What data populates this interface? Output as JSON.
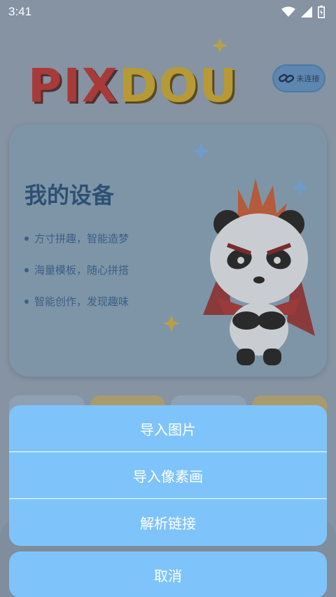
{
  "status_bar": {
    "time": "3:41",
    "icons": [
      "wifi-icon",
      "signal-icon",
      "battery-icon"
    ]
  },
  "header": {
    "logo_left": "PIX",
    "logo_right": "DOU",
    "connect_label": "未连接",
    "connect_icon": "link-icon"
  },
  "device_card": {
    "title": "我的设备",
    "features": [
      "方寸拼趣，智能造梦",
      "海量模板，随心拼搭",
      "智能创作，发现趣味"
    ]
  },
  "action_sheet": {
    "items": [
      "导入图片",
      "导入像素画",
      "解析链接"
    ],
    "cancel_label": "取消"
  },
  "colors": {
    "sheet_bg": "#7ec4fa",
    "sheet_text": "#ffffff",
    "logo_red": "#a83a3a",
    "logo_yellow": "#b79a35"
  }
}
